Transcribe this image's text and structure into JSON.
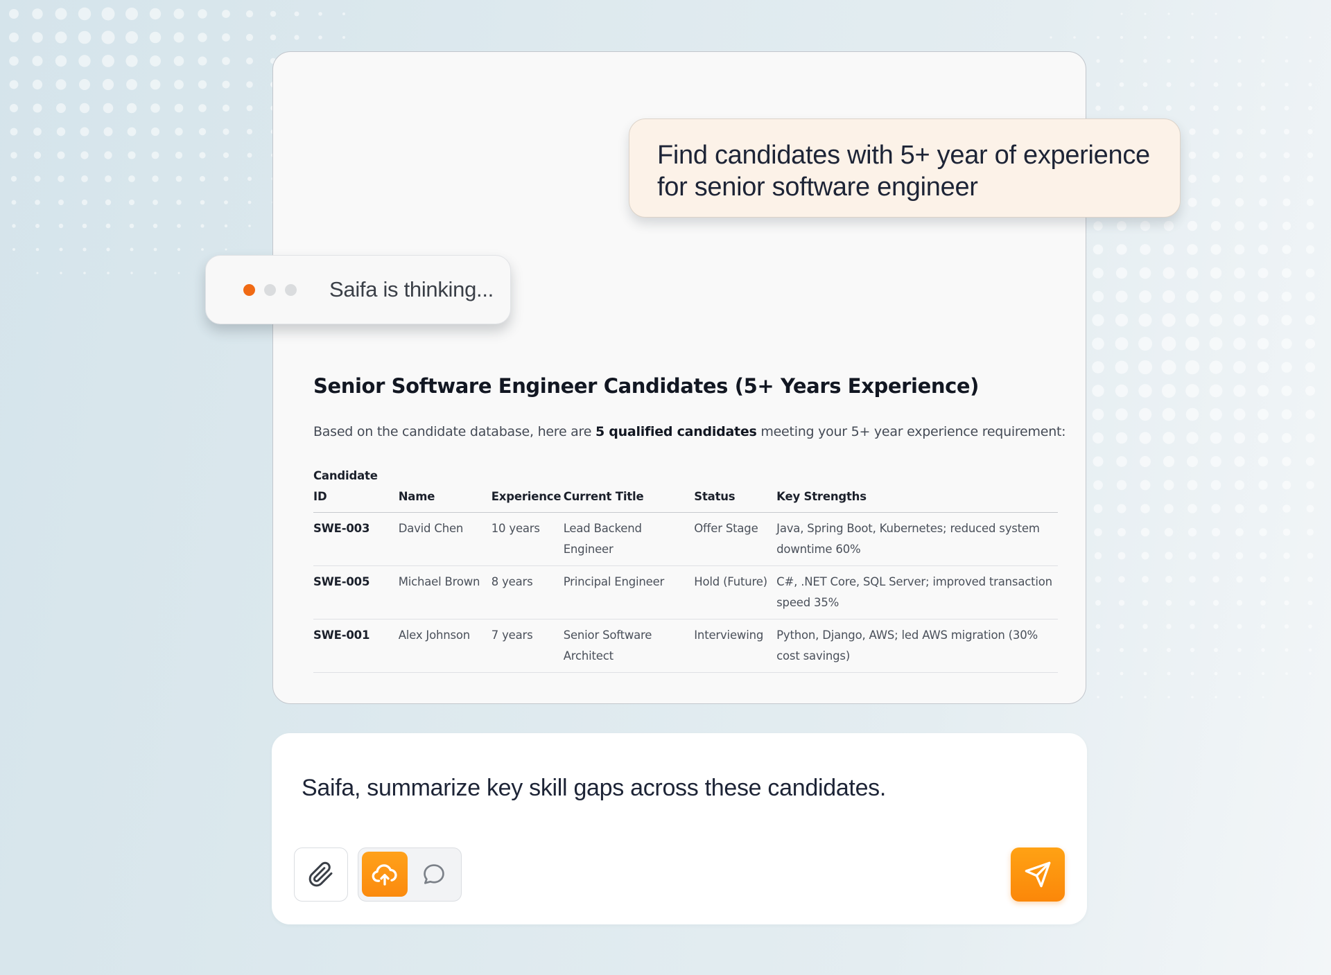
{
  "colors": {
    "accent": "#fb8a0e",
    "thinking_dot_active": "#f06a14",
    "prompt_bubble_bg": "#fcf2e8"
  },
  "conversation": {
    "user_prompt": "Find candidates with 5+ year of experience for senior software engineer",
    "thinking_text": "Saifa is thinking..."
  },
  "result": {
    "title": "Senior Software Engineer Candidates (5+ Years Experience)",
    "intro_before": "Based on the candidate database, here are ",
    "intro_bold": "5 qualified candidates",
    "intro_after": " meeting your 5+ year experience requirement:",
    "table": {
      "headers": [
        "Candidate ID",
        "Name",
        "Experience",
        "Current Title",
        "Status",
        "Key Strengths"
      ],
      "rows": [
        {
          "id": "SWE-003",
          "name": "David Chen",
          "experience": "10 years",
          "title": "Lead Backend Engineer",
          "status": "Offer Stage",
          "strengths": "Java, Spring Boot, Kubernetes; reduced system downtime 60%"
        },
        {
          "id": "SWE-005",
          "name": "Michael Brown",
          "experience": "8 years",
          "title": "Principal Engineer",
          "status": "Hold (Future)",
          "strengths": "C#, .NET Core, SQL Server; improved transaction speed 35%"
        },
        {
          "id": "SWE-001",
          "name": "Alex Johnson",
          "experience": "7 years",
          "title": "Senior Software Architect",
          "status": "Interviewing",
          "strengths": "Python, Django, AWS; led AWS migration (30% cost savings)"
        }
      ]
    }
  },
  "composer": {
    "input_text": "Saifa, summarize key skill gaps across these candidates.",
    "icons": {
      "attach": "paperclip-icon",
      "mode_active": "cloud-upload-icon",
      "mode_inactive": "chat-bubble-icon",
      "send": "send-icon"
    }
  }
}
